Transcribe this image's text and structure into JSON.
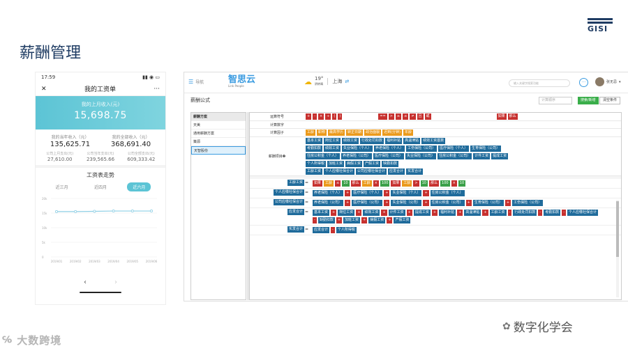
{
  "slide": {
    "title": "薪酬管理",
    "logo_text": "GISI"
  },
  "phone": {
    "status_time": "17:59",
    "nav_title": "我的工资单",
    "nav_more": "···",
    "banner_label": "我的上月收入(元)",
    "banner_value": "15,698.75",
    "stats": [
      {
        "label": "我的当年收入（元）",
        "value": "135,625.71"
      },
      {
        "label": "我的全部收入（元）",
        "value": "368,691.40"
      }
    ],
    "stats2": [
      {
        "label": "公司上月支出(元)",
        "value": "27,610.00"
      },
      {
        "label": "公司当年支出(元)",
        "value": "239,565.66"
      },
      {
        "label": "公司全部支出(元)",
        "value": "609,333.42"
      }
    ],
    "trend_title": "工资表走势",
    "tabs": [
      "近三月",
      "近四月",
      "近六月"
    ],
    "nav_prev": "‹",
    "nav_next": "›"
  },
  "chart_data": {
    "type": "line",
    "title": "",
    "x": [
      "2019/01",
      "2019/02",
      "2019/03",
      "2019/04",
      "2019/05",
      "2019/06"
    ],
    "series": [
      {
        "values": [
          15.5,
          15.5,
          15.6,
          15.7,
          15.7,
          15.7
        ]
      }
    ],
    "yticks": [
      "20k",
      "15k",
      "10k",
      "5k",
      "0"
    ],
    "ylim": [
      0,
      20
    ],
    "color": "#8ecfe5"
  },
  "app": {
    "menu_label": "导航",
    "brand": "智思云",
    "brand_sub": "Link People",
    "temp": "19°",
    "weather_note": "阴转晴",
    "city": "上海",
    "search_placeholder": "输入关键字搜索功能",
    "user_name": "张无忌",
    "page_title": "薪酬公式",
    "filter_placeholder": "计算顺序",
    "btn_search": "搜索/新增",
    "btn_clear": "清空条件",
    "side_header": "薪酬方案",
    "side_items": [
      "天美",
      "通用薪酬方案",
      "策源",
      "天智股份"
    ],
    "operators_label": "运算符号",
    "operators_a": [
      "+",
      "-",
      "×",
      "÷",
      "(",
      ")"
    ],
    "operators_b": [
      "==",
      ">",
      "≥",
      "≤",
      "≠",
      "且",
      "或"
    ],
    "operators_c": [
      "如果",
      "那么"
    ],
    "numbers_label": "计算数字",
    "factors_label": "计算因子",
    "factors": [
      "工龄",
      "职称",
      "最高学历",
      "转正日期",
      "政治面貌",
      "迟到(分钟)",
      "年龄"
    ],
    "items_label": "薪酬项目",
    "items": [
      [
        "基本工资",
        "岗位工资",
        "绩效工资",
        "行政处罚扣款",
        "福利补贴",
        "高温津贴",
        "绩效工资基数"
      ],
      [
        "考勤扣款",
        "绩效工资",
        "失业保险（个人）",
        "养老保险（个人）",
        "工伤保险（公司）",
        "医疗保险（个人）",
        "生育保险（公司）"
      ],
      [
        "住房公积金（个人）",
        "养老保险（公司）",
        "医疗保险（公司）",
        "失业保险（公司）",
        "住房公积金（公司）",
        "计件工资",
        "提成工资"
      ],
      [
        "个人所得税",
        "加班工资",
        "病假工资",
        "产假工资",
        "缺勤扣款"
      ],
      [
        "工龄工资",
        "个人应缴社保合计",
        "公司应缴社保合计",
        "应发合计",
        "实发合计"
      ]
    ],
    "formulas": [
      {
        "name": "工龄工资",
        "parts": [
          [
            "red",
            "如果"
          ],
          [
            "org",
            "工龄"
          ],
          [
            "red",
            "≤"
          ],
          [
            "grn",
            "10"
          ],
          [
            "red",
            "那么"
          ],
          [
            "org",
            "工龄"
          ],
          [
            "red",
            "×"
          ],
          [
            "grn",
            "100"
          ],
          [
            "red",
            "如果"
          ],
          [
            "org",
            "工龄"
          ],
          [
            "red",
            ">"
          ],
          [
            "grn",
            "10"
          ],
          [
            "red",
            "那么"
          ],
          [
            "grn",
            "100"
          ],
          [
            "red",
            "×"
          ],
          [
            "grn",
            "10"
          ]
        ]
      },
      {
        "name": "个人应缴社保合计",
        "parts": [
          [
            "blu",
            "养老保险（个人）"
          ],
          [
            "red",
            "+"
          ],
          [
            "blu",
            "医疗保险（个人）"
          ],
          [
            "red",
            "+"
          ],
          [
            "blu",
            "失业保险（个人）"
          ],
          [
            "red",
            "+"
          ],
          [
            "blu",
            "住房公积金（个人）"
          ]
        ]
      },
      {
        "name": "公司应缴社保合计",
        "parts": [
          [
            "blu",
            "养老保险（公司）"
          ],
          [
            "red",
            "+"
          ],
          [
            "blu",
            "医疗保险（公司）"
          ],
          [
            "red",
            "+"
          ],
          [
            "blu",
            "失业保险（公司）"
          ],
          [
            "red",
            "+"
          ],
          [
            "blu",
            "住房公积金（公司）"
          ],
          [
            "red",
            "+"
          ],
          [
            "blu",
            "生育保险（公司）"
          ],
          [
            "red",
            "+"
          ],
          [
            "blu",
            "工伤保险（公司）"
          ]
        ]
      },
      {
        "name": "应发合计",
        "parts": [
          [
            "blu",
            "基本工资"
          ],
          [
            "red",
            "+"
          ],
          [
            "blu",
            "岗位工资"
          ],
          [
            "red",
            "+"
          ],
          [
            "blu",
            "绩效工资"
          ],
          [
            "red",
            "+"
          ],
          [
            "blu",
            "计件工资"
          ],
          [
            "red",
            "+"
          ],
          [
            "blu",
            "提成工资"
          ],
          [
            "red",
            "+"
          ],
          [
            "blu",
            "福利补贴"
          ],
          [
            "red",
            "+"
          ],
          [
            "blu",
            "高温津贴"
          ],
          [
            "red",
            "+"
          ],
          [
            "blu",
            "工龄工资"
          ],
          [
            "red",
            "-"
          ],
          [
            "blu",
            "行政处罚扣款"
          ],
          [
            "red",
            "-"
          ],
          [
            "blu",
            "考勤扣款"
          ],
          [
            "red",
            "-"
          ],
          [
            "blu",
            "个人应缴社保合计"
          ],
          [
            "red",
            "-"
          ],
          [
            "blu",
            "缺勤扣款"
          ],
          [
            "red",
            "+"
          ],
          [
            "blu",
            "加班工资"
          ],
          [
            "red",
            "+"
          ],
          [
            "blu",
            "病假工资"
          ],
          [
            "red",
            "+"
          ],
          [
            "blu",
            "产假工资"
          ]
        ]
      },
      {
        "name": "实发合计",
        "parts": [
          [
            "blu",
            "应发合计"
          ],
          [
            "red",
            "-"
          ],
          [
            "blu",
            "个人所得税"
          ]
        ]
      }
    ]
  },
  "footer": {
    "left_brand": "大数跨境",
    "right_brand": "数字化学会"
  }
}
